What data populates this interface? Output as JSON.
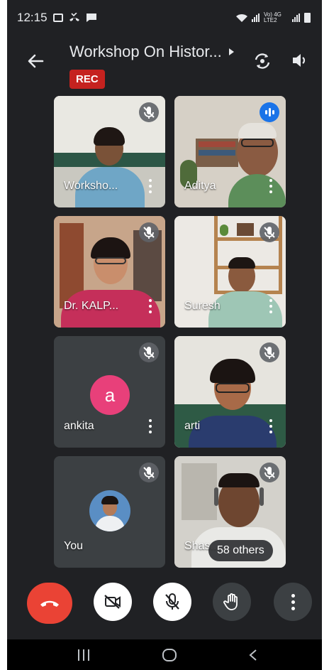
{
  "status_bar": {
    "time": "12:15",
    "network_label": "Vo) 4G LTE2"
  },
  "header": {
    "title": "Workshop On Histor...",
    "rec_badge": "REC"
  },
  "participants": [
    {
      "name": "Worksho...",
      "audio": "muted"
    },
    {
      "name": "Aditya",
      "audio": "speaking"
    },
    {
      "name": "Dr. KALP...",
      "audio": "muted"
    },
    {
      "name": "Suresh",
      "audio": "muted"
    },
    {
      "name": "ankita",
      "audio": "muted",
      "avatar_letter": "a",
      "avatar_color": "#e8407a"
    },
    {
      "name": "arti",
      "audio": "muted"
    },
    {
      "name": "You",
      "audio": "muted"
    },
    {
      "name": "Shas...",
      "audio": "muted"
    }
  ],
  "others_badge": "58 others",
  "controls": {
    "end_call_icon": "phone-hangup-icon",
    "camera_icon": "camera-off-icon",
    "mic_icon": "mic-off-icon",
    "hand_icon": "raise-hand-icon",
    "more_icon": "more-vert-icon"
  },
  "colors": {
    "background": "#202124",
    "tile": "#3c4043",
    "end_call": "#ea4335",
    "rec": "#c5221f",
    "speaking": "#1a73e8"
  }
}
